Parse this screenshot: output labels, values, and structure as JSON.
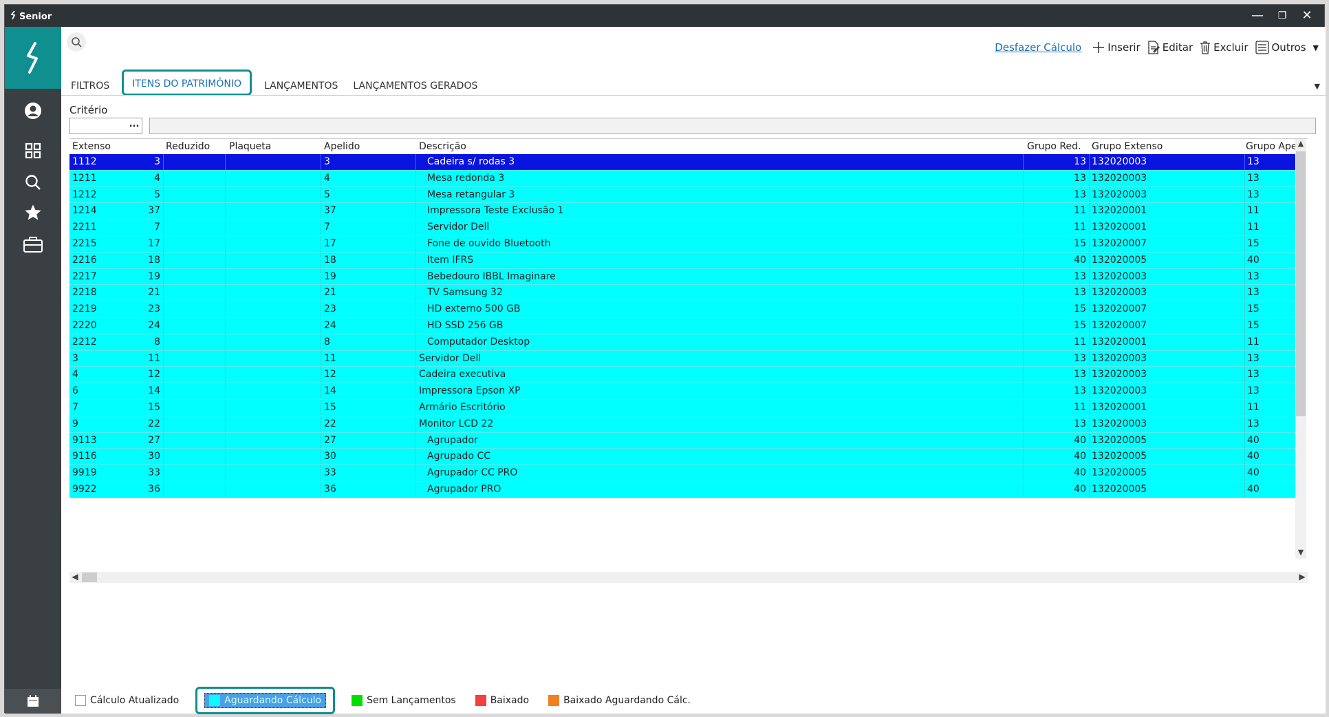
{
  "titlebar": {
    "app_name": "Senior",
    "minimize": "—",
    "restore": "❐",
    "close": "✕"
  },
  "toolbar": {
    "undo_calc": "Desfazer Cálculo",
    "insert": "Inserir",
    "edit": "Editar",
    "delete": "Excluir",
    "others": "Outros"
  },
  "tabs": [
    {
      "label": "FILTROS"
    },
    {
      "label": "ITENS DO PATRIMÔNIO"
    },
    {
      "label": "LANÇAMENTOS"
    },
    {
      "label": "LANÇAMENTOS GERADOS"
    }
  ],
  "criteria": {
    "label": "Critério",
    "dots": "..."
  },
  "grid": {
    "columns": [
      "Extenso",
      "Reduzido",
      "Plaqueta",
      "Apelido",
      "Descrição",
      "Grupo Red.",
      "Grupo Extenso",
      "Grupo Apel"
    ],
    "rows": [
      {
        "extenso": "1112",
        "reduzido": "3",
        "plaqueta": "",
        "apelido": "3",
        "descricao": "Cadeira s/ rodas 3",
        "indent": true,
        "grupo_red": "13",
        "grupo_ext": "132020003",
        "grupo_apel": "13"
      },
      {
        "extenso": "1211",
        "reduzido": "4",
        "plaqueta": "",
        "apelido": "4",
        "descricao": "Mesa redonda 3",
        "indent": true,
        "grupo_red": "13",
        "grupo_ext": "132020003",
        "grupo_apel": "13"
      },
      {
        "extenso": "1212",
        "reduzido": "5",
        "plaqueta": "",
        "apelido": "5",
        "descricao": "Mesa retangular 3",
        "indent": true,
        "grupo_red": "13",
        "grupo_ext": "132020003",
        "grupo_apel": "13"
      },
      {
        "extenso": "1214",
        "reduzido": "37",
        "plaqueta": "",
        "apelido": "37",
        "descricao": "Impressora Teste Exclusão 1",
        "indent": true,
        "grupo_red": "11",
        "grupo_ext": "132020001",
        "grupo_apel": "11"
      },
      {
        "extenso": "2211",
        "reduzido": "7",
        "plaqueta": "",
        "apelido": "7",
        "descricao": "Servidor Dell",
        "indent": true,
        "grupo_red": "11",
        "grupo_ext": "132020001",
        "grupo_apel": "11"
      },
      {
        "extenso": "2215",
        "reduzido": "17",
        "plaqueta": "",
        "apelido": "17",
        "descricao": "Fone de ouvido Bluetooth",
        "indent": true,
        "grupo_red": "15",
        "grupo_ext": "132020007",
        "grupo_apel": "15"
      },
      {
        "extenso": "2216",
        "reduzido": "18",
        "plaqueta": "",
        "apelido": "18",
        "descricao": "Item IFRS",
        "indent": true,
        "grupo_red": "40",
        "grupo_ext": "132020005",
        "grupo_apel": "40"
      },
      {
        "extenso": "2217",
        "reduzido": "19",
        "plaqueta": "",
        "apelido": "19",
        "descricao": "Bebedouro IBBL Imaginare",
        "indent": true,
        "grupo_red": "13",
        "grupo_ext": "132020003",
        "grupo_apel": "13"
      },
      {
        "extenso": "2218",
        "reduzido": "21",
        "plaqueta": "",
        "apelido": "21",
        "descricao": "TV Samsung 32",
        "indent": true,
        "grupo_red": "13",
        "grupo_ext": "132020003",
        "grupo_apel": "13"
      },
      {
        "extenso": "2219",
        "reduzido": "23",
        "plaqueta": "",
        "apelido": "23",
        "descricao": "HD externo 500 GB",
        "indent": true,
        "grupo_red": "15",
        "grupo_ext": "132020007",
        "grupo_apel": "15"
      },
      {
        "extenso": "2220",
        "reduzido": "24",
        "plaqueta": "",
        "apelido": "24",
        "descricao": "HD SSD 256 GB",
        "indent": true,
        "grupo_red": "15",
        "grupo_ext": "132020007",
        "grupo_apel": "15"
      },
      {
        "extenso": "2212",
        "reduzido": "8",
        "plaqueta": "",
        "apelido": "8",
        "descricao": "Computador Desktop",
        "indent": true,
        "grupo_red": "11",
        "grupo_ext": "132020001",
        "grupo_apel": "11"
      },
      {
        "extenso": "3",
        "reduzido": "11",
        "plaqueta": "",
        "apelido": "11",
        "descricao": "Servidor Dell",
        "indent": false,
        "grupo_red": "13",
        "grupo_ext": "132020003",
        "grupo_apel": "13"
      },
      {
        "extenso": "4",
        "reduzido": "12",
        "plaqueta": "",
        "apelido": "12",
        "descricao": "Cadeira executiva",
        "indent": false,
        "grupo_red": "13",
        "grupo_ext": "132020003",
        "grupo_apel": "13"
      },
      {
        "extenso": "6",
        "reduzido": "14",
        "plaqueta": "",
        "apelido": "14",
        "descricao": "Impressora Epson XP",
        "indent": false,
        "grupo_red": "13",
        "grupo_ext": "132020003",
        "grupo_apel": "13"
      },
      {
        "extenso": "7",
        "reduzido": "15",
        "plaqueta": "",
        "apelido": "15",
        "descricao": "Armário Escritório",
        "indent": false,
        "grupo_red": "11",
        "grupo_ext": "132020001",
        "grupo_apel": "11"
      },
      {
        "extenso": "9",
        "reduzido": "22",
        "plaqueta": "",
        "apelido": "22",
        "descricao": "Monitor LCD 22",
        "indent": false,
        "grupo_red": "13",
        "grupo_ext": "132020003",
        "grupo_apel": "13"
      },
      {
        "extenso": "9113",
        "reduzido": "27",
        "plaqueta": "",
        "apelido": "27",
        "descricao": "Agrupador",
        "indent": true,
        "grupo_red": "40",
        "grupo_ext": "132020005",
        "grupo_apel": "40"
      },
      {
        "extenso": "9116",
        "reduzido": "30",
        "plaqueta": "",
        "apelido": "30",
        "descricao": "Agrupado CC",
        "indent": true,
        "grupo_red": "40",
        "grupo_ext": "132020005",
        "grupo_apel": "40"
      },
      {
        "extenso": "9919",
        "reduzido": "33",
        "plaqueta": "",
        "apelido": "33",
        "descricao": "Agrupador CC PRO",
        "indent": true,
        "grupo_red": "40",
        "grupo_ext": "132020005",
        "grupo_apel": "40"
      },
      {
        "extenso": "9922",
        "reduzido": "36",
        "plaqueta": "",
        "apelido": "36",
        "descricao": "Agrupador PRO",
        "indent": true,
        "grupo_red": "40",
        "grupo_ext": "132020005",
        "grupo_apel": "40"
      }
    ]
  },
  "legend": [
    {
      "label": "Cálculo Atualizado",
      "color": "#ffffff"
    },
    {
      "label": "Aguardando Cálculo",
      "color": "#00ffff"
    },
    {
      "label": "Sem Lançamentos",
      "color": "#00e000"
    },
    {
      "label": "Baixado",
      "color": "#f04040"
    },
    {
      "label": "Baixado Aguardando Cálc.",
      "color": "#f08020"
    }
  ],
  "colors": {
    "accent": "#0f8f8f",
    "selected_row": "#0a14e0",
    "pending_row": "#00ffff"
  }
}
